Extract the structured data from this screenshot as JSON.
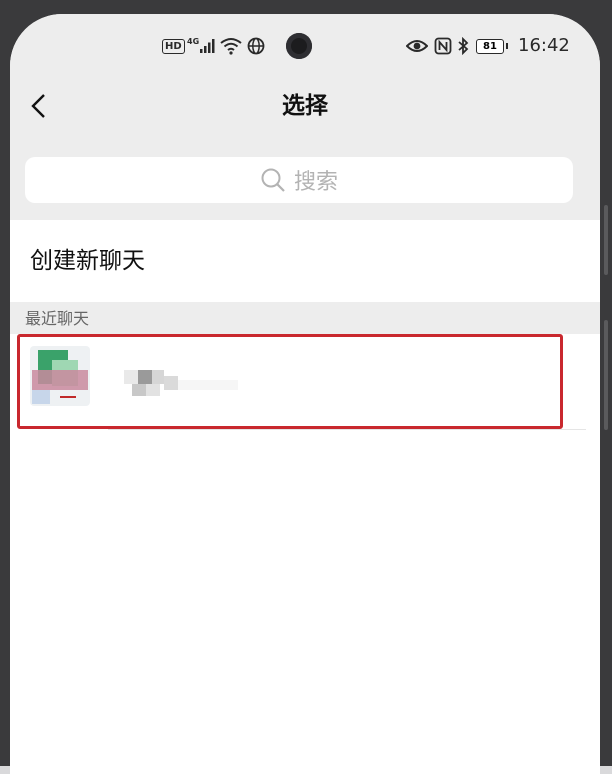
{
  "status_bar": {
    "hd_badge": "HD",
    "network": "4G",
    "battery": "81",
    "time": "16:42",
    "icons": [
      "signal-bars-icon",
      "wifi-icon",
      "globe-icon",
      "eye-icon",
      "nfc-icon",
      "bluetooth-icon",
      "battery-icon"
    ]
  },
  "nav": {
    "title": "选择",
    "back_icon": "chevron-left-icon"
  },
  "search": {
    "placeholder": "搜索",
    "icon": "search-icon"
  },
  "create_chat": {
    "label": "创建新聊天"
  },
  "recent": {
    "header": "最近聊天"
  },
  "colors": {
    "background_gray": "#ededed",
    "highlight_red": "#c9282e",
    "text_primary": "#111111",
    "text_secondary": "#666666",
    "placeholder": "#b3b3b3"
  }
}
